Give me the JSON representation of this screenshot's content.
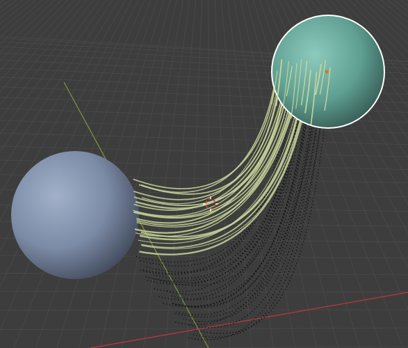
{
  "viewport": {
    "background": "#3d3d3d",
    "grid_color": "#4a4a4a",
    "x_axis_color": "#b0383e",
    "y_axis_color": "#7a9a3a"
  },
  "objects": [
    {
      "name": "sphere-left",
      "color": "#7f8ea9",
      "selected": false
    },
    {
      "name": "sphere-right",
      "color": "#64a79a",
      "selected": true,
      "outline_color": "#ffffff"
    }
  ],
  "particles": {
    "strand_color": "#c8d69a",
    "dotted_color": "#111111"
  },
  "cursor_3d": {
    "primary": "#d83a3a",
    "secondary": "#ffffff"
  },
  "origin_dot_color": "#e07020"
}
